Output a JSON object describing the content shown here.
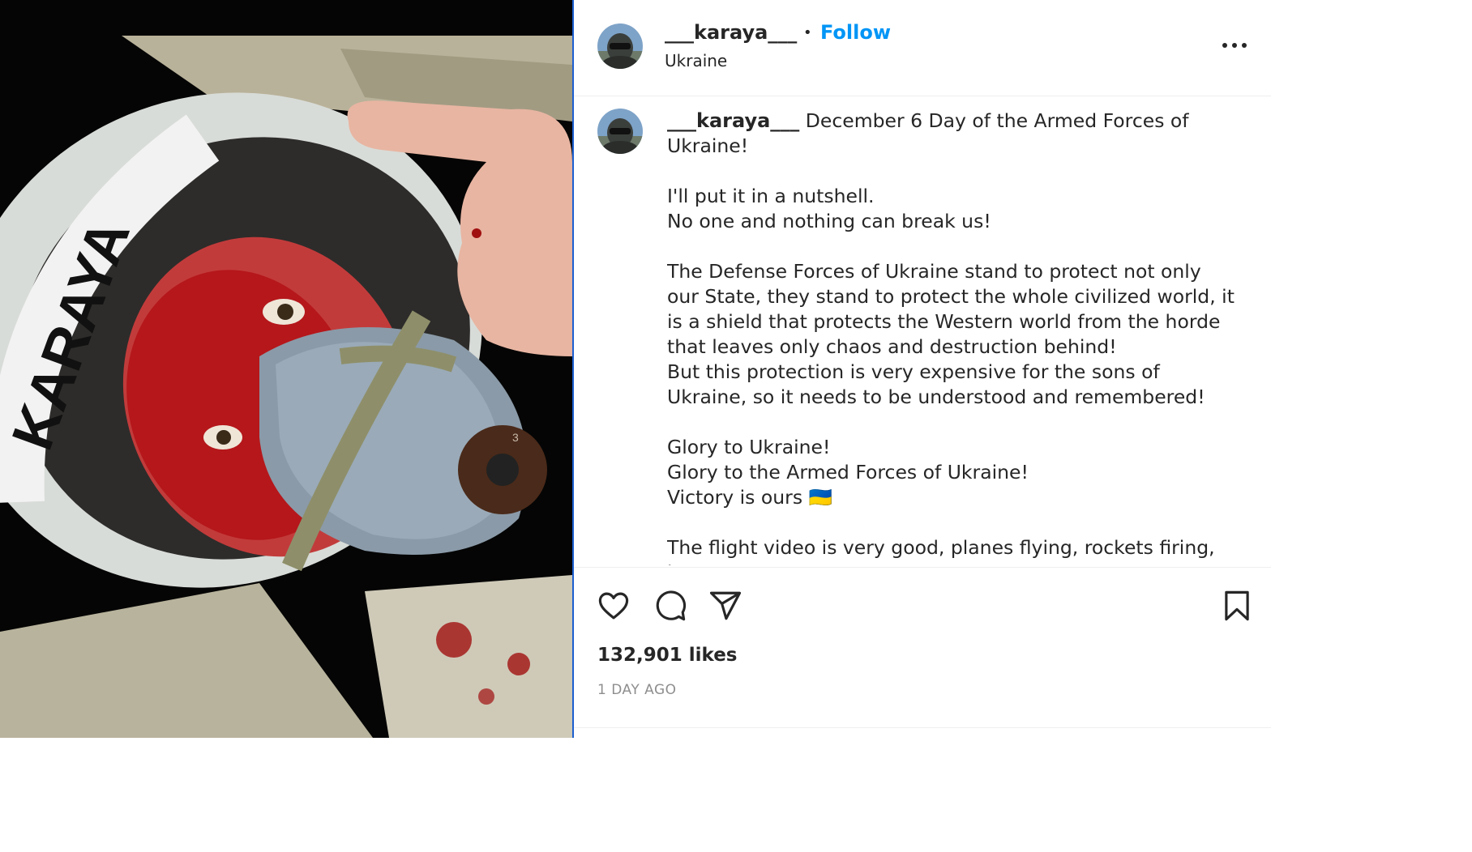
{
  "media": {
    "alt": "",
    "helmet_text": "KARAYA",
    "mask_label": "3"
  },
  "post": {
    "username": "___karaya___",
    "location": "Ukraine",
    "follow_label": "Follow",
    "separator": "•"
  },
  "caption": {
    "username": "___karaya___",
    "paragraphs": [
      " December 6 Day of the Armed Forces of Ukraine!",
      "I'll put it in a nutshell.\nNo one and nothing can break us!",
      "The Defense Forces of Ukraine stand to protect not only our State, they stand to protect the whole civilized world, it is a shield that protects the Western world from the horde that leaves only chaos and destruction behind!\nBut this protection is very expensive for the sons of Ukraine, so it needs to be understood and remembered!",
      "Glory to Ukraine!\nGlory to the Armed Forces of Ukraine!\nVictory is ours 🇺🇦",
      "The flight video is very good, planes flying, rockets firing, but"
    ]
  },
  "actions": {
    "like_icon": "heart-icon",
    "comment_icon": "comment-icon",
    "share_icon": "paper-plane-icon",
    "save_icon": "bookmark-icon"
  },
  "stats": {
    "likes": "132,901 likes",
    "timestamp": "1 DAY AGO"
  },
  "colors": {
    "link": "#0095f6",
    "text": "#262626",
    "muted": "#8e8e8e",
    "divider": "#1d5fd0"
  }
}
